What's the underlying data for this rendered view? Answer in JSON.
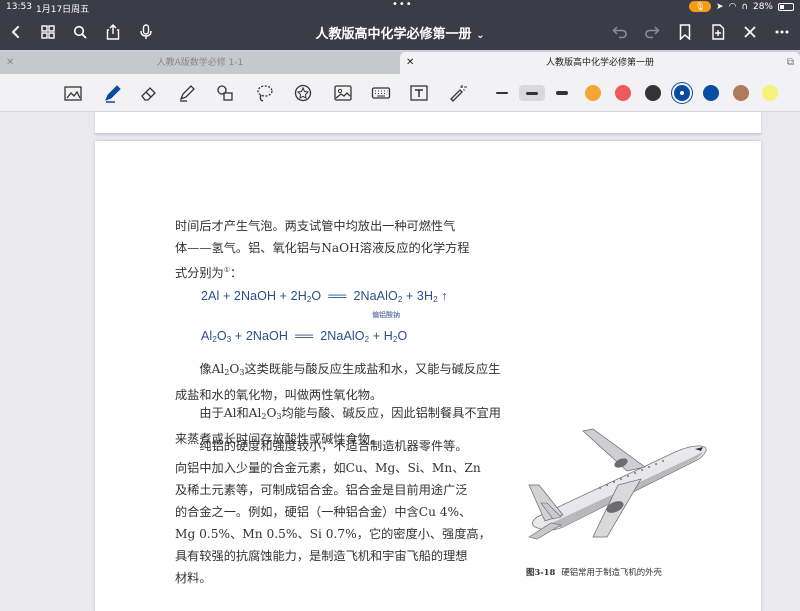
{
  "status_bar": {
    "time": "13:53",
    "date": "1月17日周五",
    "mic": "🎙",
    "battery": "28%"
  },
  "nav": {
    "title": "人教版高中化学必修第一册",
    "title_chevron": "⌄"
  },
  "tabs": [
    {
      "label": "人教A版数学必修 1-1",
      "active": false
    },
    {
      "label": "人教版高中化学必修第一册",
      "active": true
    }
  ],
  "toolbar": {
    "tools": [
      "lasso-read-icon",
      "pen-icon",
      "eraser-icon",
      "highlighter-icon",
      "shapes-icon",
      "lasso-icon",
      "sticker-icon",
      "image-icon",
      "keyboard-icon",
      "text-box-icon",
      "laser-pointer-icon"
    ],
    "stroke_widths": [
      "thin",
      "medium",
      "thick"
    ],
    "selected_stroke": "medium",
    "colors": [
      "#f4a533",
      "#ef5b5b",
      "#333333",
      "#0b4aa0",
      "#0a4ea3",
      "#b07a5d",
      "#f7f27a"
    ],
    "selected_color": "#0b4aa0"
  },
  "document": {
    "para1": [
      "时间后才产生气泡。两支试管中均放出一种可燃性气",
      "体——氢气。铝、氧化铝与NaOH溶液反应的化学方程",
      "式分别为",
      "①",
      "："
    ],
    "eq1": {
      "lhs": "2Al + 2NaOH + 2H",
      "lhs_sub": "2",
      "lhs_end": "O",
      "arrow": "══",
      "rhs": "2NaAlO",
      "rhs_sub": "2",
      "rhs_end": " + 3H",
      "rhs_sub2": "2",
      "gas": "↑",
      "note": "偏铝酸钠"
    },
    "eq2": {
      "a": "Al",
      "a_sub1": "2",
      "b": "O",
      "b_sub": "3",
      "c": " + 2NaOH",
      "arrow": "══",
      "d": "2NaAlO",
      "d_sub": "2",
      "e": " + H",
      "e_sub": "2",
      "f": "O"
    },
    "para2": {
      "a": "像Al",
      "a_sub1": "2",
      "b": "O",
      "b_sub": "3",
      "c": "这类既能与酸反应生成盐和水，又能与碱反",
      "d": "应生成盐和水的氧化物，叫做两性氧化物。"
    },
    "para3": {
      "a": "由于Al和Al",
      "a_sub": "2",
      "b": "O",
      "b_sub": "3",
      "c": "均能与酸、碱反应，因此铝制餐具不",
      "d": "宜用来蒸煮或长时间存放酸性或碱性食物。"
    },
    "para4": [
      "纯铝的硬度和强度较小，不适合制造机器零件等。",
      "向铝中加入少量的合金元素，如Cu、Mg、Si、Mn、Zn",
      "及稀土元素等，可制成铝合金。铝合金是目前用途广泛",
      "的合金之一。例如，硬铝（一种铝合金）中含Cu 4%、",
      "Mg 0.5%、Mn 0.5%、Si 0.7%，它的密度小、强度高，",
      "具有较强的抗腐蚀能力，是制造飞机和宇宙飞船的理想",
      "材料。"
    ],
    "figure_label": "图3-18",
    "figure_caption": "硬铝常用于制造飞机的外壳"
  }
}
